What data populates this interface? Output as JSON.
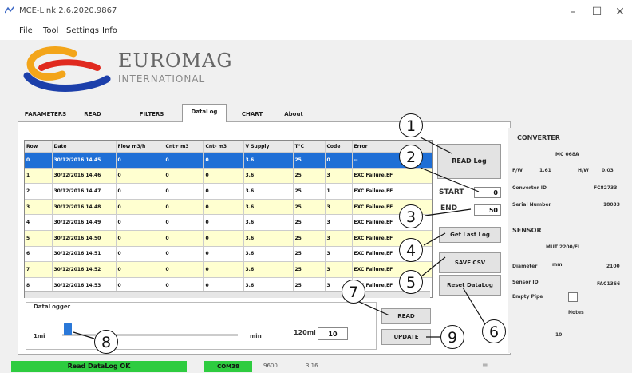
{
  "window": {
    "title": "MCE-Link 2.6.2020.9867",
    "minimize": "–",
    "maximize": "☐",
    "close": "✕"
  },
  "menu": [
    "File",
    "Tool",
    "Settings",
    "Info"
  ],
  "logo": {
    "word": "EUROMAG",
    "sub": "INTERNATIONAL"
  },
  "tabs": [
    "PARAMETERS",
    "READ",
    "FILTERS",
    "DataLog",
    "CHART",
    "About"
  ],
  "active_tab": "DataLog",
  "table": {
    "columns": [
      "Row",
      "Date",
      "Flow m3/h",
      "Cnt+ m3",
      "Cnt- m3",
      "V Supply",
      "T°C",
      "Code",
      "Error"
    ],
    "rows": [
      [
        "0",
        "30/12/2016 14.45",
        "0",
        "0",
        "0",
        "3.6",
        "25",
        "0",
        "--"
      ],
      [
        "1",
        "30/12/2016 14.46",
        "0",
        "0",
        "0",
        "3.6",
        "25",
        "3",
        "EXC Failure,EF"
      ],
      [
        "2",
        "30/12/2016 14.47",
        "0",
        "0",
        "0",
        "3.6",
        "25",
        "1",
        "EXC Failure,EF"
      ],
      [
        "3",
        "30/12/2016 14.48",
        "0",
        "0",
        "0",
        "3.6",
        "25",
        "3",
        "EXC Failure,EF"
      ],
      [
        "4",
        "30/12/2016 14.49",
        "0",
        "0",
        "0",
        "3.6",
        "25",
        "3",
        "EXC Failure,EF"
      ],
      [
        "5",
        "30/12/2016 14.50",
        "0",
        "0",
        "0",
        "3.6",
        "25",
        "3",
        "EXC Failure,EF"
      ],
      [
        "6",
        "30/12/2016 14.51",
        "0",
        "0",
        "0",
        "3.6",
        "25",
        "3",
        "EXC Failure,EF"
      ],
      [
        "7",
        "30/12/2016 14.52",
        "0",
        "0",
        "0",
        "3.6",
        "25",
        "3",
        "EXC Failure,EF"
      ],
      [
        "8",
        "30/12/2016 14.53",
        "0",
        "0",
        "0",
        "3.6",
        "25",
        "3",
        "EXC Failure,EF"
      ]
    ]
  },
  "controls": {
    "read_log": "READ Log",
    "start_label": "START",
    "start_value": "0",
    "end_label": "END",
    "end_value": "50",
    "get_last_log": "Get Last Log",
    "save_csv": "SAVE CSV",
    "reset_datalog": "Reset DataLog"
  },
  "datalogger": {
    "title": "DataLogger",
    "min_label": "1mi",
    "unit": "min",
    "max_label": "120mi",
    "value": "10",
    "slider_level_fraction": 0.0,
    "read": "READ",
    "update": "UPDATE"
  },
  "converter": {
    "title": "CONVERTER",
    "model": "MC 068A",
    "fw_label": "F/W",
    "fw": "1.61",
    "hw_label": "H/W",
    "hw": "0.03",
    "id_label": "Converter ID",
    "id": "FC82733",
    "serial_label": "Serial Number",
    "serial": "18033"
  },
  "sensor": {
    "title": "SENSOR",
    "model": "MUT 2200/EL",
    "diameter_label": "Diameter",
    "diameter_unit": "mm",
    "diameter": "2100",
    "id_label": "Sensor ID",
    "id": "FAC1366",
    "empty_pipe_label": "Empty Pipe",
    "notes_label": "Notes",
    "notes": "10"
  },
  "callouts": [
    "1",
    "2",
    "3",
    "4",
    "5",
    "6",
    "7",
    "8",
    "9"
  ],
  "status": {
    "message": "Read DataLog OK",
    "port": "COM38",
    "baud": "9600",
    "version": "3.16",
    "indicator": "≡"
  },
  "colors": {
    "selection": "#1f6fd6",
    "row_alt": "#ffffd0",
    "status_ok": "#2ecc40",
    "status_port": "#2ecc40"
  }
}
